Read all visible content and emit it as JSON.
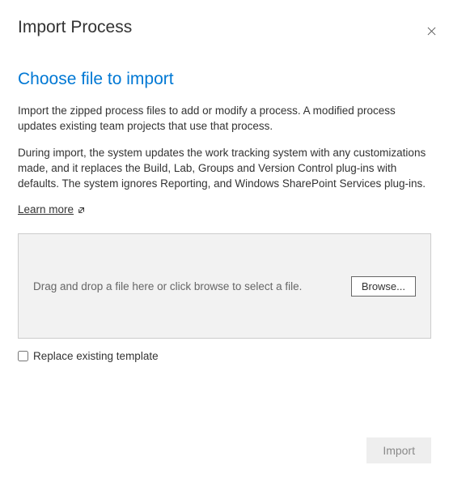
{
  "dialog": {
    "title": "Import Process",
    "subtitle": "Choose file to import",
    "description1": "Import the zipped process files to add or modify a process. A modified process updates existing team projects that use that process.",
    "description2": "During import, the system updates the work tracking system with any customizations made, and it replaces the Build, Lab, Groups and Version Control plug-ins with defaults. The system ignores Reporting, and Windows SharePoint Services plug-ins.",
    "learn_more_label": "Learn more",
    "dropzone": {
      "hint": "Drag and drop a file here or click browse to select a file.",
      "browse_label": "Browse..."
    },
    "checkbox": {
      "label": "Replace existing template",
      "checked": false
    },
    "footer": {
      "import_label": "Import",
      "import_enabled": false
    }
  }
}
